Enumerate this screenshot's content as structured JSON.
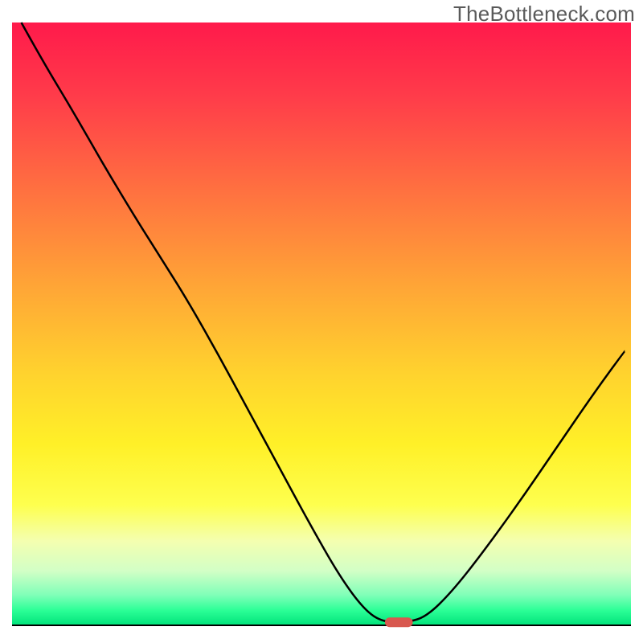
{
  "watermark": "TheBottleneck.com",
  "chart_data": {
    "type": "line",
    "title": "",
    "xlabel": "",
    "ylabel": "",
    "xlim": [
      0,
      100
    ],
    "ylim": [
      0,
      100
    ],
    "background": {
      "type": "vertical-gradient",
      "stops": [
        {
          "offset": 0.0,
          "color": "#ff1a4b"
        },
        {
          "offset": 0.12,
          "color": "#ff3b4a"
        },
        {
          "offset": 0.28,
          "color": "#ff7140"
        },
        {
          "offset": 0.44,
          "color": "#ffa636"
        },
        {
          "offset": 0.58,
          "color": "#ffd22e"
        },
        {
          "offset": 0.7,
          "color": "#fff028"
        },
        {
          "offset": 0.8,
          "color": "#feff4e"
        },
        {
          "offset": 0.86,
          "color": "#f4ffb0"
        },
        {
          "offset": 0.91,
          "color": "#d2ffc6"
        },
        {
          "offset": 0.95,
          "color": "#7fffb8"
        },
        {
          "offset": 0.975,
          "color": "#2cff97"
        },
        {
          "offset": 1.0,
          "color": "#00e37a"
        }
      ]
    },
    "series": [
      {
        "name": "bottleneck-curve",
        "color": "#000000",
        "width": 2.5,
        "points": [
          {
            "x": 1.5,
            "y": 100.0
          },
          {
            "x": 5.0,
            "y": 93.5
          },
          {
            "x": 10.0,
            "y": 85.0
          },
          {
            "x": 15.0,
            "y": 76.0
          },
          {
            "x": 20.0,
            "y": 67.5
          },
          {
            "x": 24.0,
            "y": 61.0
          },
          {
            "x": 28.0,
            "y": 54.5
          },
          {
            "x": 33.0,
            "y": 45.5
          },
          {
            "x": 38.0,
            "y": 36.0
          },
          {
            "x": 43.0,
            "y": 26.5
          },
          {
            "x": 48.0,
            "y": 17.0
          },
          {
            "x": 53.0,
            "y": 8.0
          },
          {
            "x": 57.0,
            "y": 2.5
          },
          {
            "x": 60.0,
            "y": 0.5
          },
          {
            "x": 64.0,
            "y": 0.5
          },
          {
            "x": 67.0,
            "y": 1.5
          },
          {
            "x": 71.0,
            "y": 5.5
          },
          {
            "x": 76.0,
            "y": 12.0
          },
          {
            "x": 82.0,
            "y": 20.5
          },
          {
            "x": 88.0,
            "y": 29.5
          },
          {
            "x": 94.0,
            "y": 38.5
          },
          {
            "x": 99.0,
            "y": 45.5
          }
        ]
      }
    ],
    "marker": {
      "name": "optimal-point",
      "x": 62.5,
      "y": 0.5,
      "width": 4.5,
      "height": 1.6,
      "color": "#d8584f"
    },
    "baseline": {
      "y": 0,
      "color": "#000000",
      "width": 2
    }
  }
}
